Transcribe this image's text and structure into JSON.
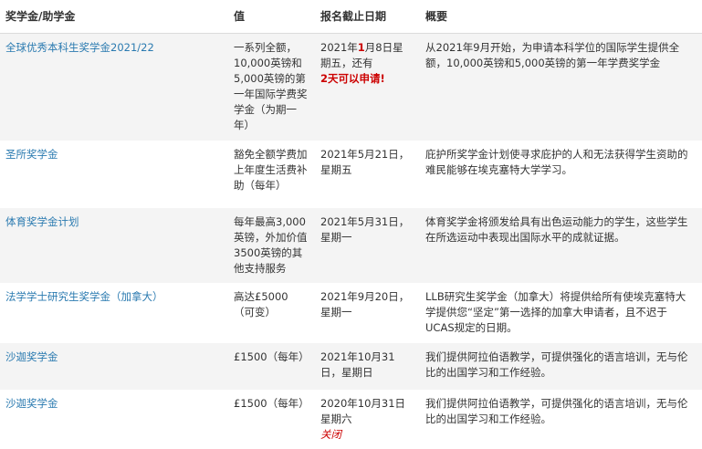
{
  "table": {
    "headers": [
      "奖学金/助学金",
      "值",
      "报名截止日期",
      "概要"
    ],
    "rows": [
      {
        "name": "全球优秀本科生奖学金2021/22",
        "value": "一系列全额，10,000英镑和5,000英镑的第一年国际学费奖学金（为期一年）",
        "deadline_pre": "2021年",
        "deadline_hl": "1",
        "deadline_post": "月8日星期五，还有",
        "deadline_note": "2天可以申请!",
        "summary": "从2021年9月开始，为申请本科学位的国际学生提供全额，10,000英镑和5,000英镑的第一年学费奖学金"
      },
      {
        "name": "圣所奖学金",
        "value": "豁免全额学费加上年度生活费补助（每年）",
        "deadline": "2021年5月21日，星期五",
        "summary": "庇护所奖学金计划使寻求庇护的人和无法获得学生资助的难民能够在埃克塞特大学学习。"
      },
      {
        "name": "体育奖学金计划",
        "value": "每年最高3,000英镑，外加价值3500英镑的其他支持服务",
        "deadline": "2021年5月31日，星期一",
        "summary": "体育奖学金将颁发给具有出色运动能力的学生，这些学生在所选运动中表现出国际水平的成就证据。"
      },
      {
        "name": "法学学士研究生奖学金（加拿大）",
        "value": "高达£5000（可变）",
        "deadline": "2021年9月20日，星期一",
        "summary": "LLB研究生奖学金（加拿大）将提供给所有使埃克塞特大学提供您“坚定”第一选择的加拿大申请者，且不迟于UCAS规定的日期。"
      },
      {
        "name": "沙迦奖学金",
        "value": "£1500（每年）",
        "deadline": "2021年10月31日，星期日",
        "summary": "我们提供阿拉伯语教学，可提供强化的语言培训，无与伦比的出国学习和工作经验。"
      },
      {
        "name": "沙迦奖学金",
        "value": "£1500（每年）",
        "deadline": "2020年10月31日星期六",
        "deadline_note": "关闭",
        "summary": "我们提供阿拉伯语教学，可提供强化的语言培训，无与伦比的出国学习和工作经验。"
      }
    ]
  }
}
